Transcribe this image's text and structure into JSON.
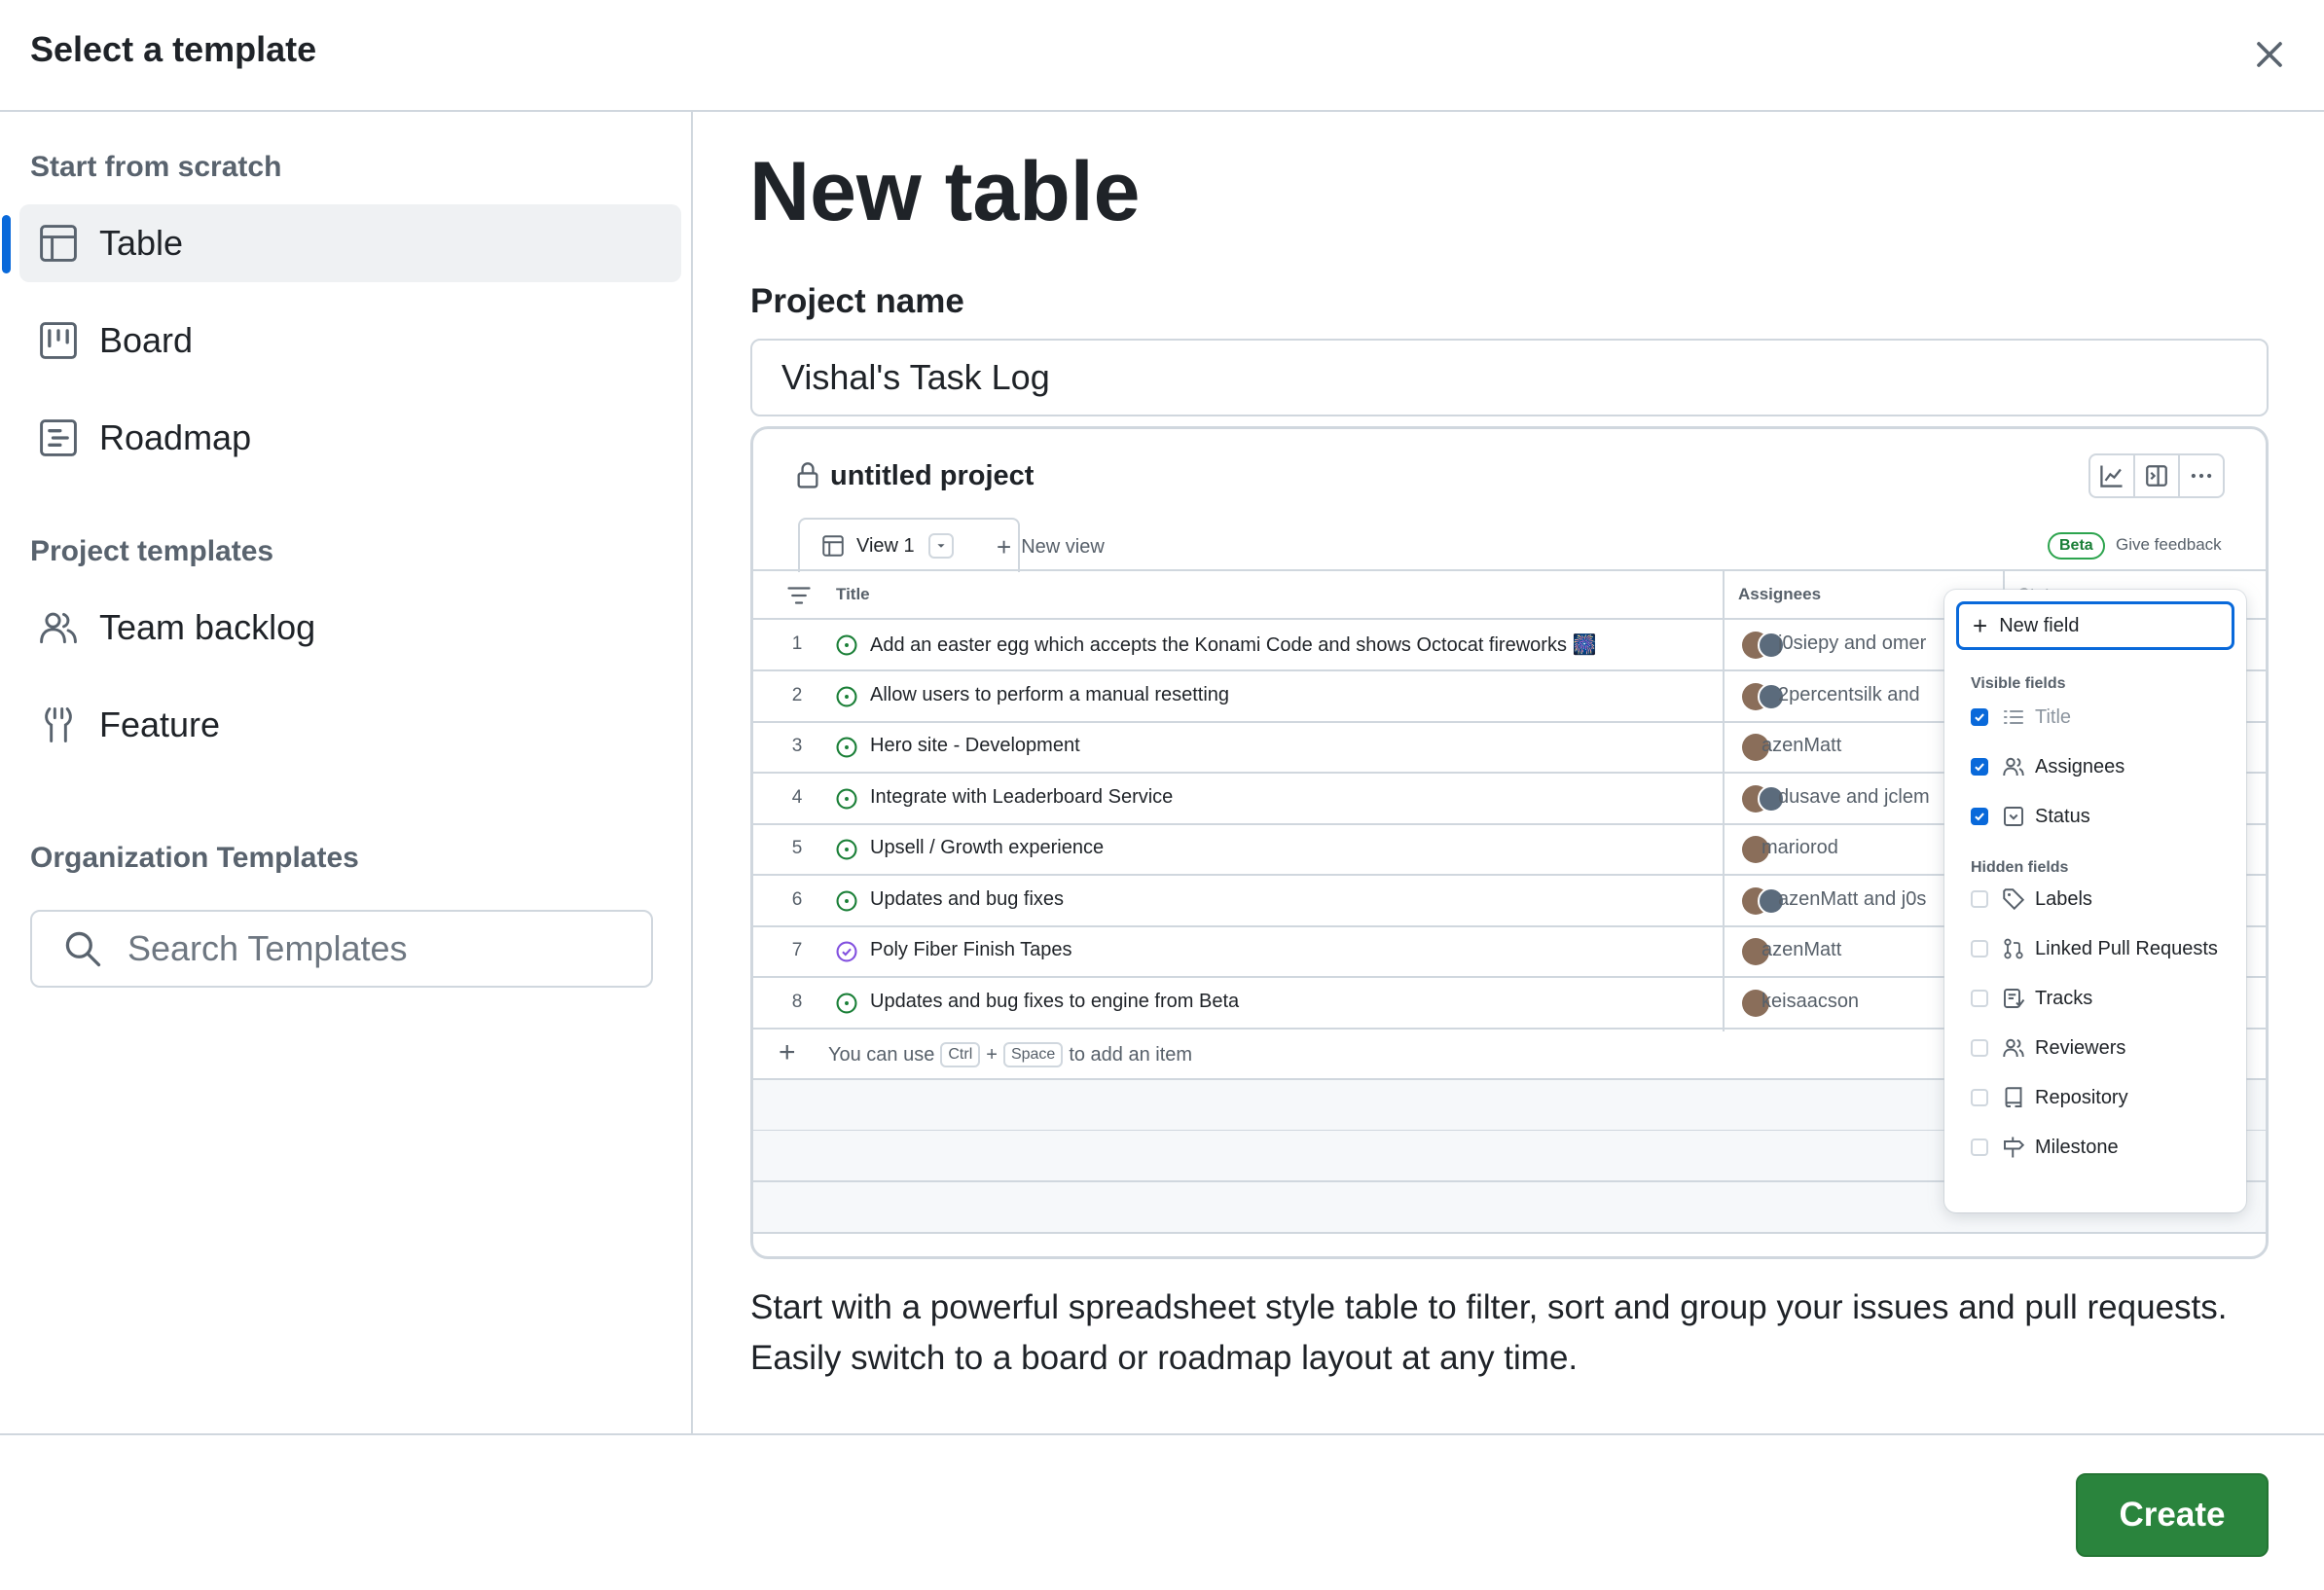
{
  "dialog": {
    "title": "Select a template",
    "close_icon": "x-icon"
  },
  "sidebar": {
    "scratch_heading": "Start from scratch",
    "scratch_items": [
      {
        "label": "Table",
        "icon": "table-icon",
        "selected": true
      },
      {
        "label": "Board",
        "icon": "project-board-icon",
        "selected": false
      },
      {
        "label": "Roadmap",
        "icon": "roadmap-icon",
        "selected": false
      }
    ],
    "project_templates_heading": "Project templates",
    "project_templates": [
      {
        "label": "Team backlog",
        "icon": "people-icon"
      },
      {
        "label": "Feature",
        "icon": "feature-icon"
      }
    ],
    "org_templates_heading": "Organization Templates",
    "search_placeholder": "Search Templates"
  },
  "main": {
    "title": "New table",
    "project_name_label": "Project name",
    "project_name_value": "Vishal's Task Log",
    "description": "Start with a powerful spreadsheet style table to filter, sort and group your issues and pull requests. Easily switch to a board or roadmap layout at any time."
  },
  "preview": {
    "project_title": "untitled project",
    "tab_label": "View 1",
    "new_view_label": "New view",
    "beta_label": "Beta",
    "feedback_label": "Give feedback",
    "columns": {
      "title": "Title",
      "assignees": "Assignees",
      "status": "Status"
    },
    "rows": [
      {
        "num": "1",
        "title": "Add an easter egg which accepts the Konami Code and shows Octocat fireworks 🎆",
        "assignees": "j0siepy and omer",
        "state": "open",
        "multi": true
      },
      {
        "num": "2",
        "title": "Allow users to perform a manual resetting",
        "assignees": "2percentsilk and",
        "state": "open",
        "multi": true
      },
      {
        "num": "3",
        "title": "Hero site - Development",
        "assignees": "azenMatt",
        "state": "open",
        "multi": false
      },
      {
        "num": "4",
        "title": "Integrate with Leaderboard Service",
        "assignees": "dusave and jclem",
        "state": "open",
        "multi": true
      },
      {
        "num": "5",
        "title": "Upsell / Growth experience",
        "assignees": "mariorod",
        "state": "open",
        "multi": false
      },
      {
        "num": "6",
        "title": "Updates and bug fixes",
        "assignees": "azenMatt and j0s",
        "state": "open",
        "multi": true
      },
      {
        "num": "7",
        "title": "Poly Fiber Finish Tapes",
        "assignees": "azenMatt",
        "state": "done",
        "multi": false
      },
      {
        "num": "8",
        "title": "Updates and bug fixes to engine from Beta",
        "assignees": "keisaacson",
        "state": "open",
        "multi": false
      }
    ],
    "add_item": {
      "prefix": "You can use",
      "key1": "Ctrl",
      "plus": "+",
      "key2": "Space",
      "suffix": "to add an item"
    },
    "fields_menu": {
      "new_field": "New field",
      "visible_heading": "Visible fields",
      "visible": [
        {
          "label": "Title",
          "icon": "list-icon",
          "checked": true,
          "dim": true
        },
        {
          "label": "Assignees",
          "icon": "people-icon",
          "checked": true
        },
        {
          "label": "Status",
          "icon": "single-select-icon",
          "checked": true
        }
      ],
      "hidden_heading": "Hidden fields",
      "hidden": [
        {
          "label": "Labels",
          "icon": "tag-icon"
        },
        {
          "label": "Linked Pull Requests",
          "icon": "git-pull-request-icon"
        },
        {
          "label": "Tracks",
          "icon": "tracks-icon"
        },
        {
          "label": "Reviewers",
          "icon": "people-icon"
        },
        {
          "label": "Repository",
          "icon": "repo-icon"
        },
        {
          "label": "Milestone",
          "icon": "milestone-icon"
        }
      ]
    }
  },
  "footer": {
    "create_label": "Create"
  },
  "colors": {
    "accent": "#0969da",
    "create_button": "#2a843d",
    "open_issue": "#1a7f37",
    "done_issue": "#8250df"
  }
}
